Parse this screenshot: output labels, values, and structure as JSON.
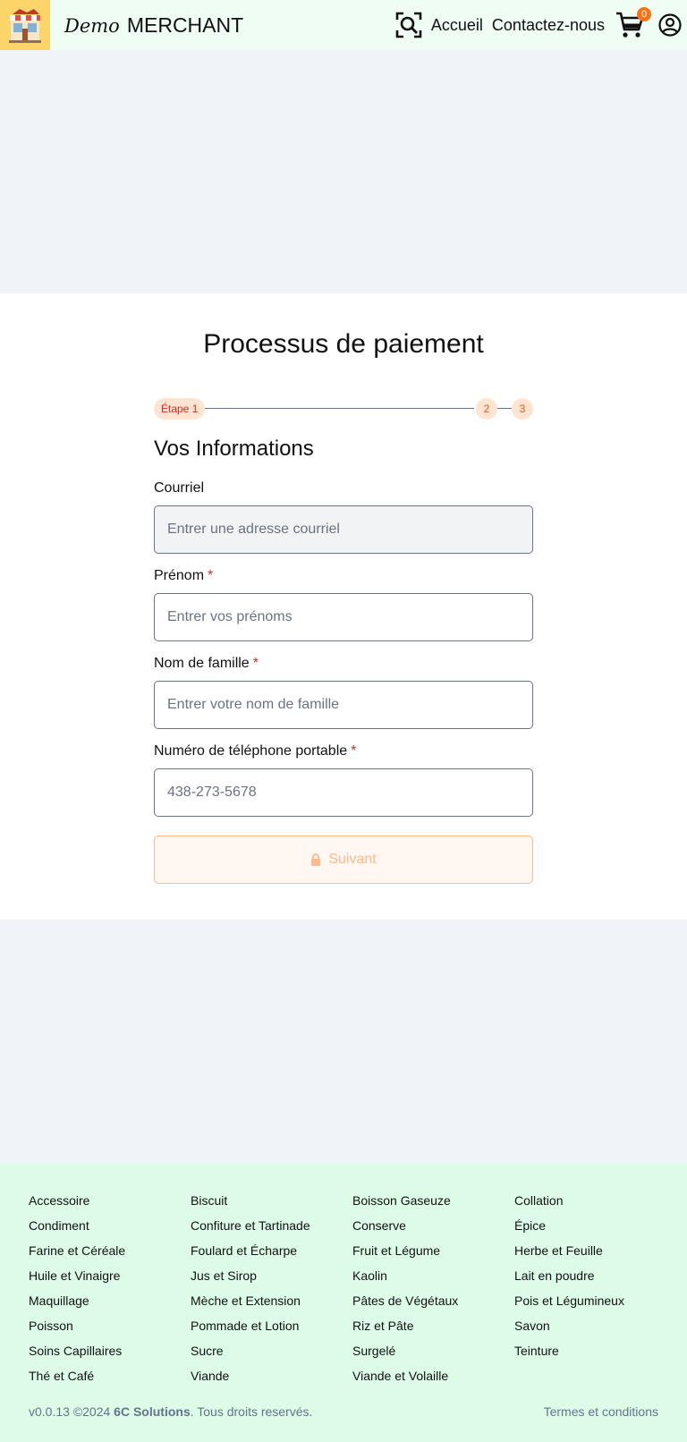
{
  "header": {
    "brand_demo": "Demo",
    "brand_name": "MERCHANT",
    "nav_home": "Accueil",
    "nav_contact": "Contactez-nous",
    "cart_count": "0"
  },
  "checkout": {
    "title": "Processus de paiement",
    "step1_label": "Étape 1",
    "step2_label": "2",
    "step3_label": "3",
    "section_title": "Vos Informations",
    "email_label": "Courriel",
    "email_placeholder": "Entrer une adresse courriel",
    "firstname_label": "Prénom",
    "firstname_placeholder": "Entrer vos prénoms",
    "lastname_label": "Nom de famille",
    "lastname_placeholder": "Entrer votre nom de famille",
    "phone_label": "Numéro de téléphone portable",
    "phone_placeholder": "438-273-5678",
    "required_mark": "*",
    "next_button": "Suivant"
  },
  "footer": {
    "categories": [
      "Accessoire",
      "Biscuit",
      "Boisson Gaseuze",
      "Collation",
      "Condiment",
      "Confiture et Tartinade",
      "Conserve",
      "Épice",
      "Farine et Céréale",
      "Foulard et Écharpe",
      "Fruit et Légume",
      "Herbe et Feuille",
      "Huile et Vinaigre",
      "Jus et Sirop",
      "Kaolin",
      "Lait en poudre",
      "Maquillage",
      "Mèche et Extension",
      "Pâtes de Végétaux",
      "Pois et Légumineux",
      "Poisson",
      "Pommade et Lotion",
      "Riz et Pâte",
      "Savon",
      "Soins Capillaires",
      "Sucre",
      "Surgelé",
      "Teinture",
      "Thé et Café",
      "Viande",
      "Viande et Volaille"
    ],
    "version": "v0.0.13 ©2024",
    "company": "6C Solutions",
    "rights": ". Tous droits reservés.",
    "terms": "Termes et conditions"
  },
  "colors": {
    "header_bg": "#f0fdf4",
    "accent": "#f97316",
    "required": "#dc2626",
    "footer_bg": "#dcfce7"
  },
  "icons": [
    "shop-logo",
    "search-icon",
    "cart-icon",
    "account-icon",
    "lock-icon"
  ]
}
